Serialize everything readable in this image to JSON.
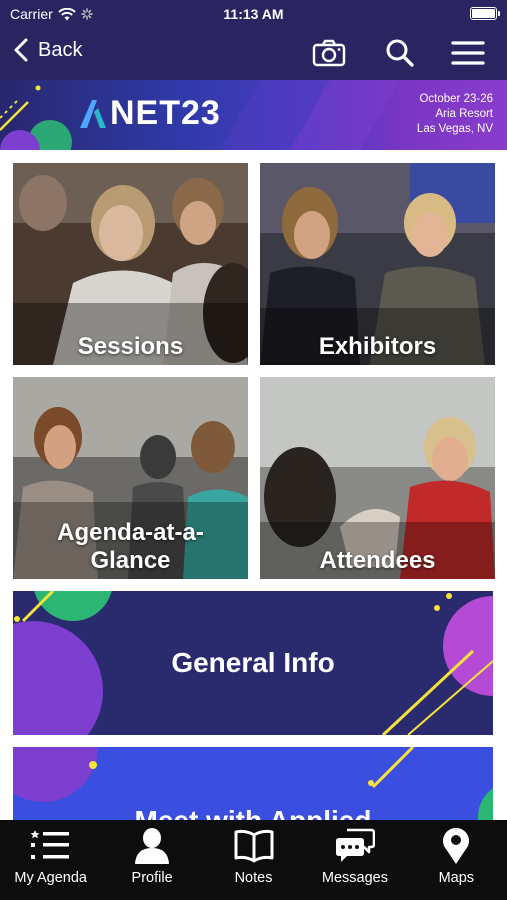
{
  "status_bar": {
    "carrier": "Carrier",
    "time": "11:13 AM"
  },
  "nav": {
    "back_label": "Back",
    "icons": [
      "camera-icon",
      "search-icon",
      "menu-icon"
    ]
  },
  "banner": {
    "logo_text": "NET23",
    "date": "October 23-26",
    "venue": "Aria Resort",
    "city": "Las Vegas, NV"
  },
  "tiles": [
    {
      "label": "Sessions"
    },
    {
      "label": "Exhibitors"
    },
    {
      "label": "Agenda-at-a-Glance"
    },
    {
      "label": "Attendees"
    }
  ],
  "cards": [
    {
      "label": "General  Info"
    },
    {
      "label": "Meet with Applied"
    }
  ],
  "tab_bar": [
    {
      "label": "My Agenda",
      "icon": "list-icon"
    },
    {
      "label": "Profile",
      "icon": "person-icon"
    },
    {
      "label": "Notes",
      "icon": "book-icon"
    },
    {
      "label": "Messages",
      "icon": "chat-icon"
    },
    {
      "label": "Maps",
      "icon": "map-pin-icon"
    }
  ],
  "colors": {
    "primary": "#2a2560",
    "accent_green": "#2bb673",
    "accent_purple": "#8a3ccc",
    "accent_yellow": "#f5e33a",
    "tab_bg": "#0d0d0d"
  }
}
